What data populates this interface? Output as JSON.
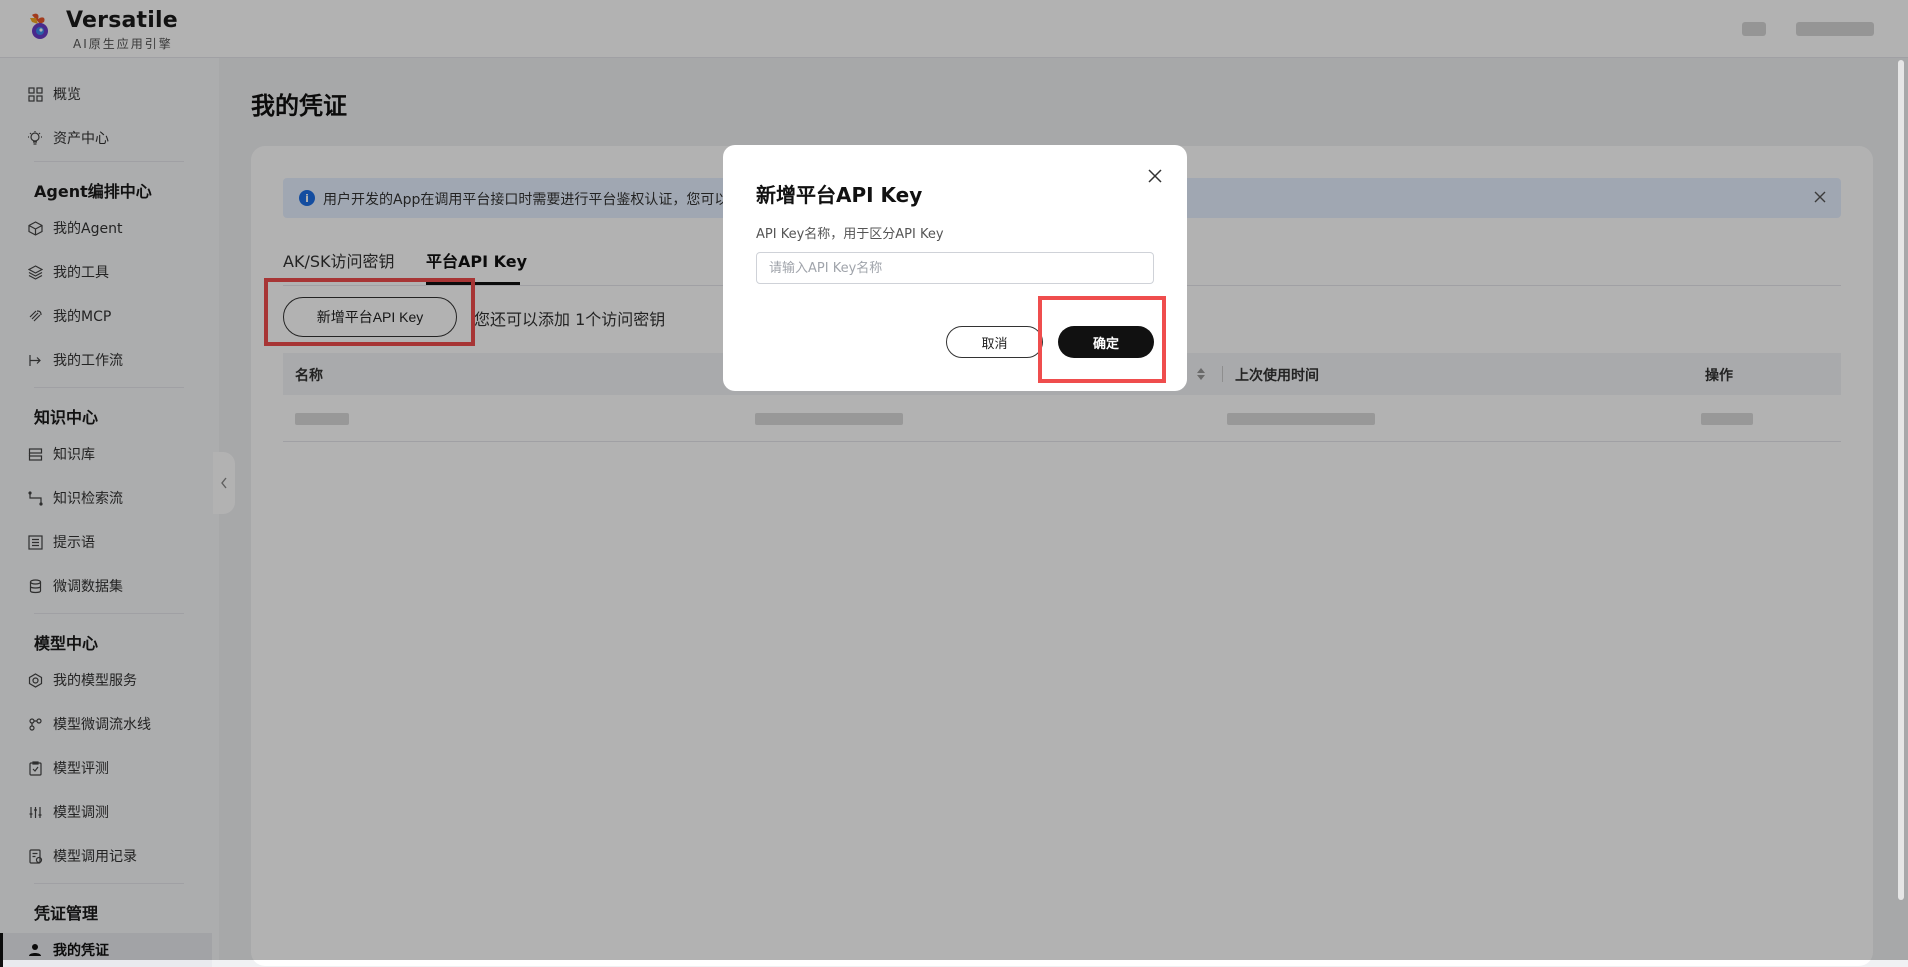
{
  "colors": {
    "accent": "#111111",
    "highlight": "#ef4d4d",
    "info": "#1e6fe6"
  },
  "header": {
    "brand_name": "Versatile",
    "brand_sub": "AI原生应用引擎"
  },
  "sidebar": {
    "items": [
      {
        "label": "概览",
        "icon": "grid-icon"
      },
      {
        "label": "资产中心",
        "icon": "bulb-icon"
      },
      {
        "label": "我的Agent",
        "icon": "cube-icon"
      },
      {
        "label": "我的工具",
        "icon": "layers-icon"
      },
      {
        "label": "我的MCP",
        "icon": "mcp-icon"
      },
      {
        "label": "我的工作流",
        "icon": "workflow-icon"
      },
      {
        "label": "知识库",
        "icon": "database-icon"
      },
      {
        "label": "知识检索流",
        "icon": "flow-icon"
      },
      {
        "label": "提示语",
        "icon": "list-icon"
      },
      {
        "label": "微调数据集",
        "icon": "dataset-icon"
      },
      {
        "label": "我的模型服务",
        "icon": "model-icon"
      },
      {
        "label": "模型微调流水线",
        "icon": "pipeline-icon"
      },
      {
        "label": "模型评测",
        "icon": "clipboard-icon"
      },
      {
        "label": "模型调测",
        "icon": "sliders-icon"
      },
      {
        "label": "模型调用记录",
        "icon": "record-icon"
      },
      {
        "label": "我的凭证",
        "icon": "user-icon"
      }
    ],
    "groups": [
      "Agent编排中心",
      "知识中心",
      "模型中心",
      "凭证管理"
    ]
  },
  "main": {
    "title": "我的凭证",
    "alert_text": "用户开发的App在调用平台接口时需要进行平台鉴权认证，您可以",
    "tabs": [
      "AK/SK访问密钥",
      "平台API Key"
    ],
    "add_button": "新增平台API Key",
    "hint": "您还可以添加 1个访问密钥",
    "columns": [
      "名称",
      "上次使用时间",
      "操作"
    ]
  },
  "modal": {
    "title": "新增平台API Key",
    "label": "API Key名称，用于区分API Key",
    "placeholder": "请输入API Key名称",
    "cancel": "取消",
    "ok": "确定"
  }
}
